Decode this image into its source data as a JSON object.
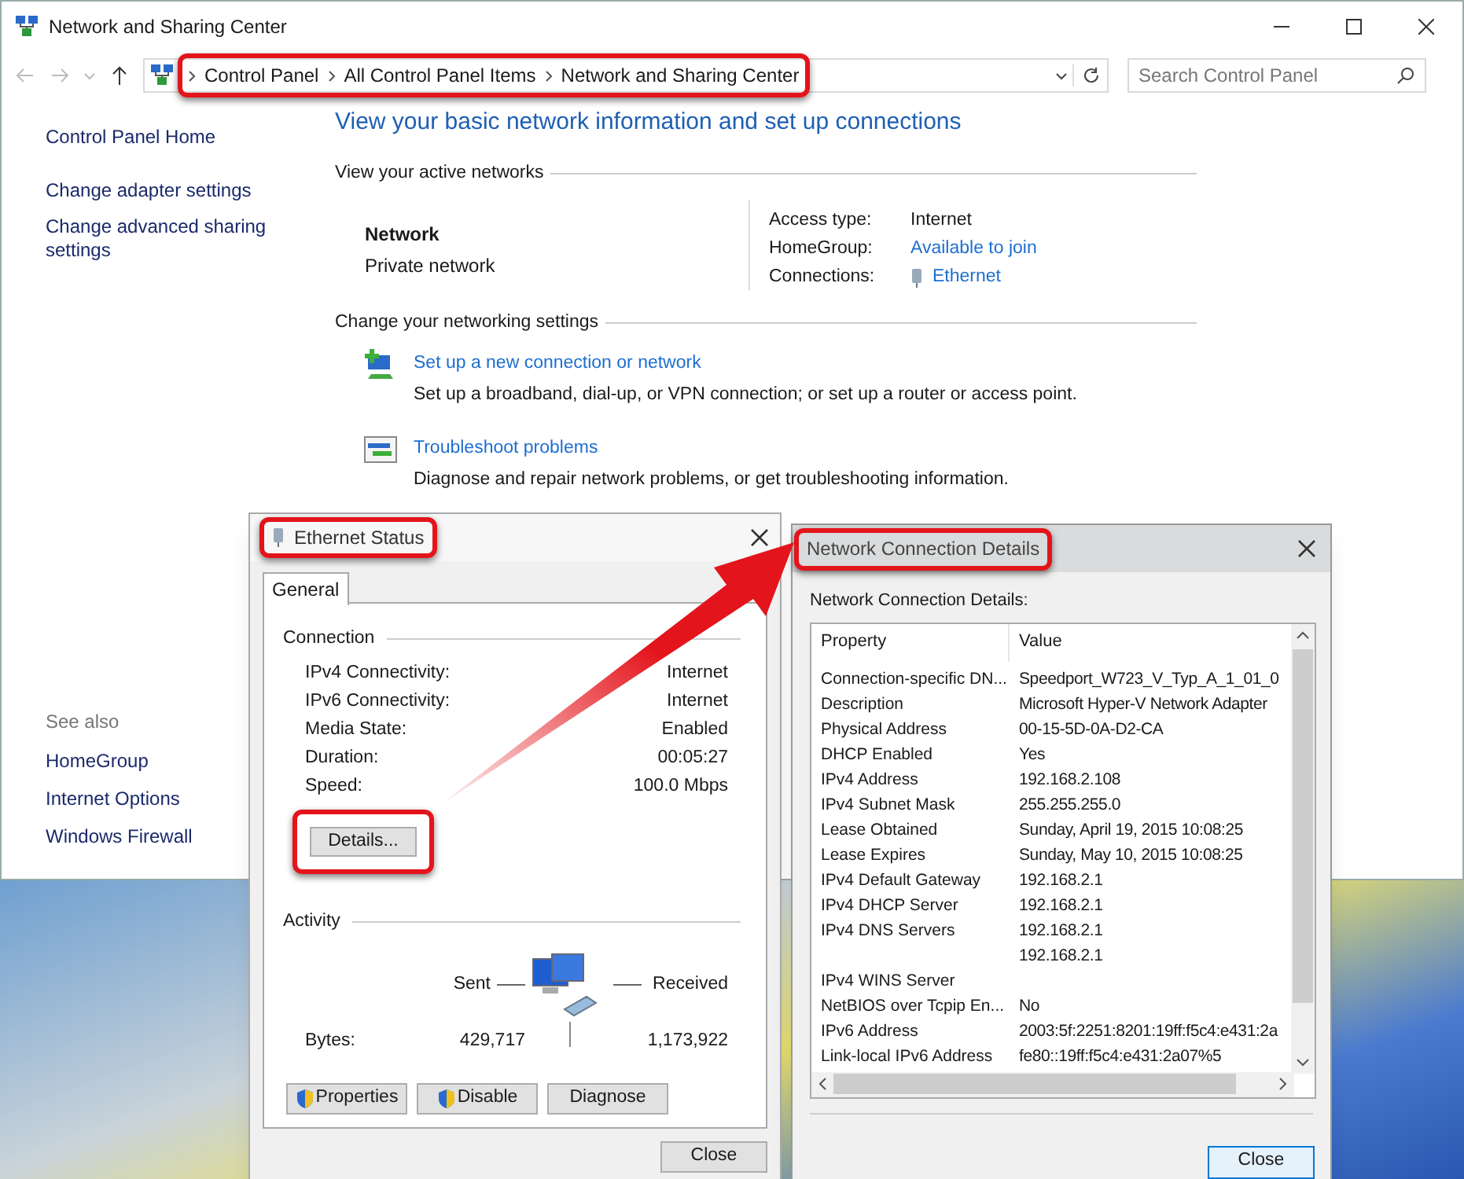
{
  "window": {
    "title": "Network and Sharing Center"
  },
  "address_bar": {
    "breadcrumb": [
      "Control Panel",
      "All Control Panel Items",
      "Network and Sharing Center"
    ]
  },
  "search": {
    "placeholder": "Search Control Panel"
  },
  "sidebar": {
    "items": [
      "Control Panel Home",
      "Change adapter settings",
      "Change advanced sharing settings"
    ],
    "see_also_heading": "See also",
    "see_also": [
      "HomeGroup",
      "Internet Options",
      "Windows Firewall"
    ]
  },
  "main": {
    "heading": "View your basic network information and set up connections",
    "active_networks_heading": "View your active networks",
    "network": {
      "name": "Network",
      "type": "Private network"
    },
    "properties": [
      {
        "label": "Access type:",
        "value": "Internet",
        "kind": "text"
      },
      {
        "label": "HomeGroup:",
        "value": "Available to join",
        "kind": "link"
      },
      {
        "label": "Connections:",
        "value": "Ethernet",
        "kind": "connection"
      }
    ],
    "settings_heading": "Change your networking settings",
    "tasks": [
      {
        "kind": "new-connection",
        "title": "Set up a new connection or network",
        "description": "Set up a broadband, dial-up, or VPN connection; or set up a router or access point."
      },
      {
        "kind": "troubleshoot",
        "title": "Troubleshoot problems",
        "description": "Diagnose and repair network problems, or get troubleshooting information."
      }
    ]
  },
  "ethernet_status": {
    "title": "Ethernet Status",
    "tabs": [
      {
        "label": "General",
        "selected": true
      }
    ],
    "connection_heading": "Connection",
    "connection": [
      {
        "label": "IPv4 Connectivity:",
        "value": "Internet"
      },
      {
        "label": "IPv6 Connectivity:",
        "value": "Internet"
      },
      {
        "label": "Media State:",
        "value": "Enabled"
      },
      {
        "label": "Duration:",
        "value": "00:05:27"
      },
      {
        "label": "Speed:",
        "value": "100.0 Mbps"
      }
    ],
    "details_button": "Details...",
    "activity_heading": "Activity",
    "sent_label": "Sent",
    "received_label": "Received",
    "bytes_label": "Bytes:",
    "bytes_sent": "429,717",
    "bytes_received": "1,173,922",
    "buttons": [
      {
        "label": "Properties",
        "shield": true
      },
      {
        "label": "Disable",
        "shield": true
      },
      {
        "label": "Diagnose",
        "shield": false
      }
    ],
    "close_button": "Close"
  },
  "details_dialog": {
    "title": "Network Connection Details",
    "caption": "Network Connection Details:",
    "columns": [
      "Property",
      "Value"
    ],
    "rows": [
      [
        "Connection-specific DN...",
        "Speedport_W723_V_Typ_A_1_01_0"
      ],
      [
        "Description",
        "Microsoft Hyper-V Network Adapter"
      ],
      [
        "Physical Address",
        "00-15-5D-0A-D2-CA"
      ],
      [
        "DHCP Enabled",
        "Yes"
      ],
      [
        "IPv4 Address",
        "192.168.2.108"
      ],
      [
        "IPv4 Subnet Mask",
        "255.255.255.0"
      ],
      [
        "Lease Obtained",
        "Sunday, April 19, 2015 10:08:25"
      ],
      [
        "Lease Expires",
        "Sunday, May 10, 2015 10:08:25"
      ],
      [
        "IPv4 Default Gateway",
        "192.168.2.1"
      ],
      [
        "IPv4 DHCP Server",
        "192.168.2.1"
      ],
      [
        "IPv4 DNS Servers",
        "192.168.2.1"
      ],
      [
        "",
        "192.168.2.1"
      ],
      [
        "IPv4 WINS Server",
        ""
      ],
      [
        "NetBIOS over Tcpip En...",
        "No"
      ],
      [
        "IPv6 Address",
        "2003:5f:2251:8201:19ff:f5c4:e431:2a"
      ],
      [
        "Link-local IPv6 Address",
        "fe80::19ff:f5c4:e431:2a07%5"
      ]
    ],
    "close_button": "Close"
  }
}
